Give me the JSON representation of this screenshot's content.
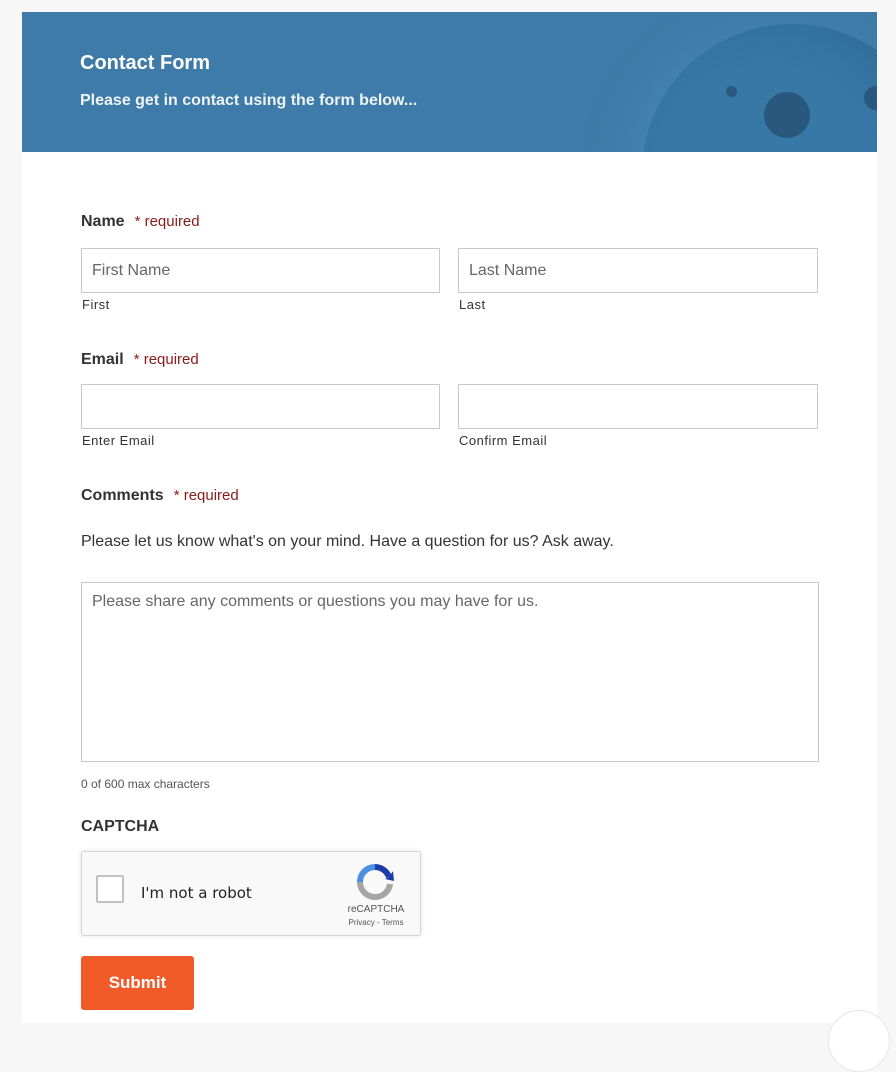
{
  "header": {
    "title": "Contact Form",
    "subtitle": "Please get in contact using the form below..."
  },
  "name_field": {
    "label": "Name",
    "required": "* required",
    "first_placeholder": "First Name",
    "last_placeholder": "Last Name",
    "first_sublabel": "First",
    "last_sublabel": "Last"
  },
  "email_field": {
    "label": "Email",
    "required": "* required",
    "enter_value": "",
    "confirm_value": "",
    "enter_sublabel": "Enter Email",
    "confirm_sublabel": "Confirm Email"
  },
  "comments_field": {
    "label": "Comments",
    "required": "* required",
    "help": "Please let us know what's on your mind. Have a question for us? Ask away.",
    "placeholder": "Please share any comments or questions you may have for us.",
    "counter": "0 of 600 max characters"
  },
  "captcha": {
    "label": "CAPTCHA",
    "checkbox_text": "I'm not a robot",
    "brand": "reCAPTCHA",
    "links": "Privacy - Terms"
  },
  "submit_label": "Submit",
  "colors": {
    "header_bg": "#3e7ba8",
    "required": "#8b1a1a",
    "submit_bg": "#f05a28"
  }
}
